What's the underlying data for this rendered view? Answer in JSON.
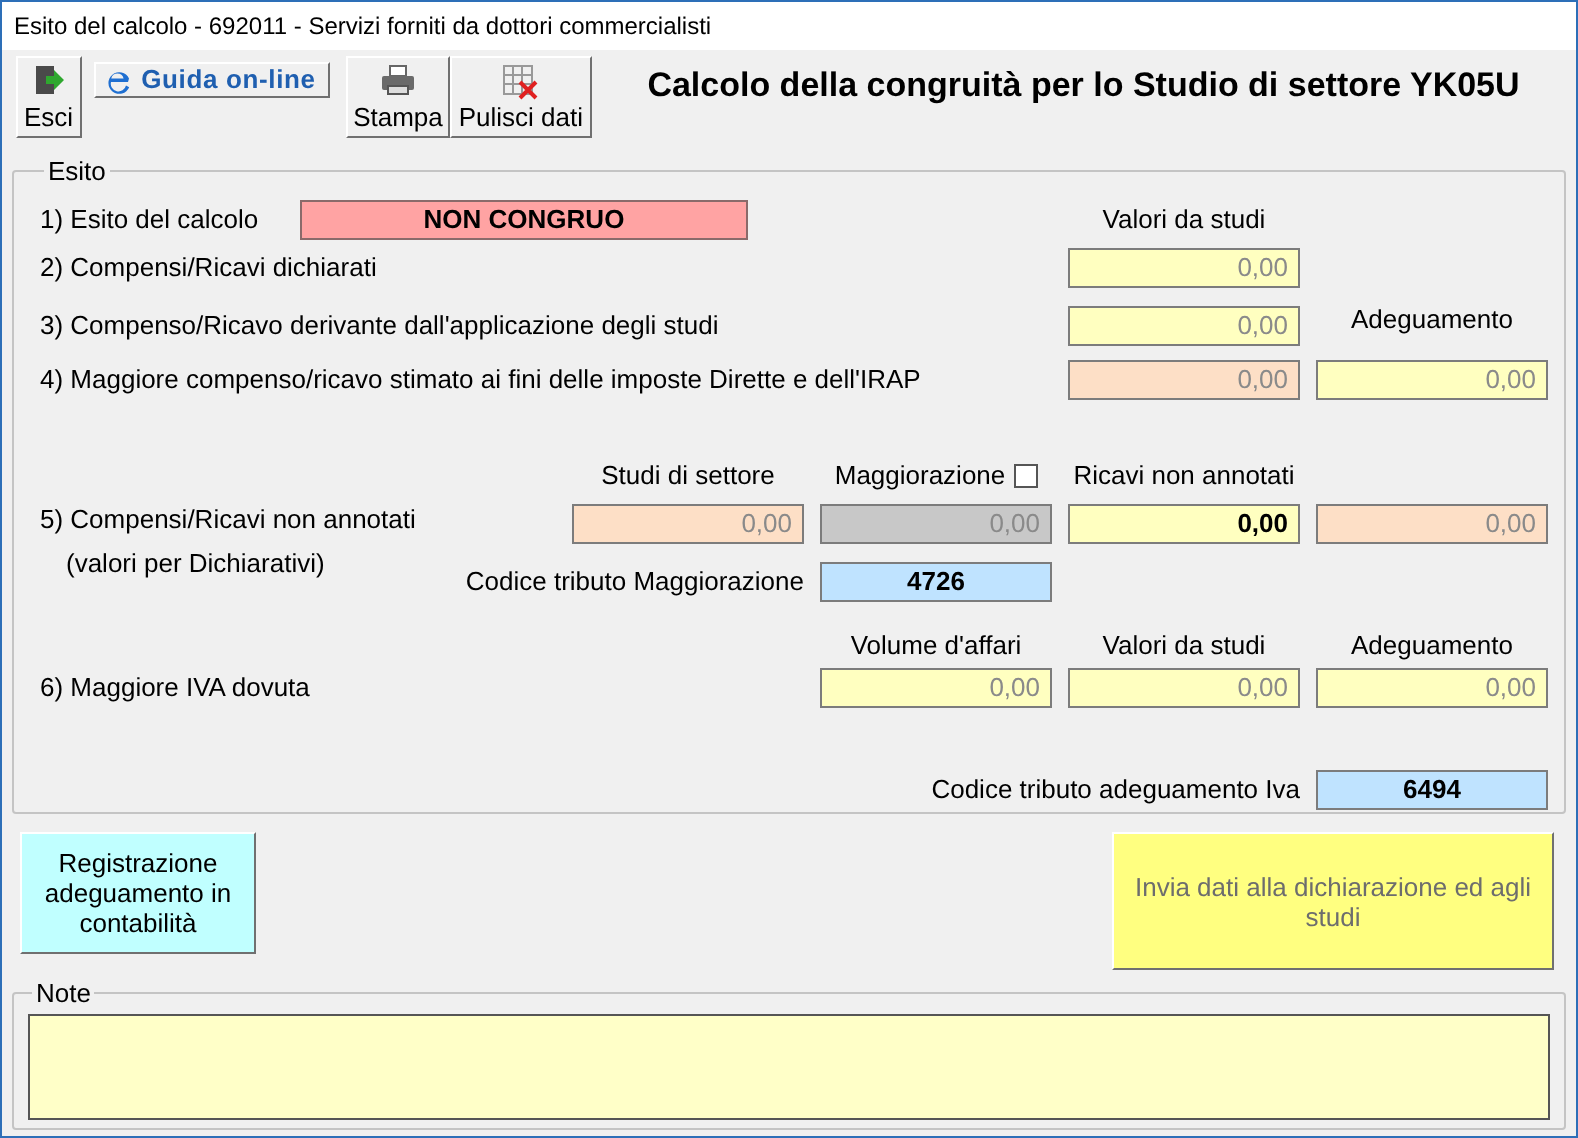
{
  "window": {
    "title": "Esito del calcolo - 692011 - Servizi forniti da dottori commercialisti"
  },
  "toolbar": [
    {
      "kind": "exit",
      "label": "Esci"
    },
    {
      "kind": "help",
      "label": "Guida on-line"
    },
    {
      "kind": "print",
      "label": "Stampa"
    },
    {
      "kind": "clear",
      "label": "Pulisci dati"
    }
  ],
  "heading": "Calcolo della congruità per lo Studio di settore YK05U",
  "esito": {
    "legend": "Esito",
    "outcome": {
      "label": "1) Esito del calcolo",
      "value": "NON CONGRUO"
    },
    "header_studi": "Valori da studi",
    "declared": {
      "label": "2) Compensi/Ricavi dichiarati",
      "studi": {
        "value": "0,00",
        "kind": "study"
      }
    },
    "derived": {
      "label": "3) Compenso/Ricavo derivante dall'applicazione degli studi",
      "studi": {
        "value": "0,00",
        "kind": "study"
      }
    },
    "header_adeguamento": "Adeguamento",
    "estimated": {
      "label": "4) Maggiore compenso/ricavo stimato ai fini delle imposte Dirette e dell'IRAP",
      "studi": {
        "value": "0,00",
        "kind": "estimate"
      },
      "adeguamento": {
        "value": "0,00",
        "kind": "study"
      }
    },
    "unrecorded": {
      "label": "5) Compensi/Ricavi non annotati",
      "note": "(valori per Dichiarativi)",
      "headers": [
        {
          "label": "Studi di settore"
        },
        {
          "label": "Maggiorazione",
          "checkbox": {
            "checked": false
          }
        },
        {
          "label": "Ricavi non annotati"
        }
      ],
      "fields": [
        {
          "value": "0,00",
          "kind": "estimate"
        },
        {
          "value": "0,00",
          "kind": "disabled"
        },
        {
          "value": "0,00",
          "kind": "input"
        },
        {
          "value": "0,00",
          "kind": "estimate"
        }
      ],
      "code": {
        "label": "Codice tributo Maggiorazione",
        "value": "4726"
      }
    },
    "vat": {
      "label": "6) Maggiore IVA dovuta",
      "headers": [
        "Volume d'affari",
        "Valori da studi",
        "Adeguamento"
      ],
      "fields": [
        {
          "value": "0,00",
          "kind": "study"
        },
        {
          "value": "0,00",
          "kind": "study"
        },
        {
          "value": "0,00",
          "kind": "study"
        }
      ],
      "code": {
        "label": "Codice tributo adeguamento Iva",
        "value": "6494"
      }
    }
  },
  "actions": [
    {
      "kind": "register",
      "label": "Registrazione adeguamento in contabilità",
      "disabled": false
    },
    {
      "kind": "send",
      "label": "Invia dati alla dichiarazione ed agli studi",
      "disabled": true
    }
  ],
  "notes": {
    "legend": "Note"
  }
}
